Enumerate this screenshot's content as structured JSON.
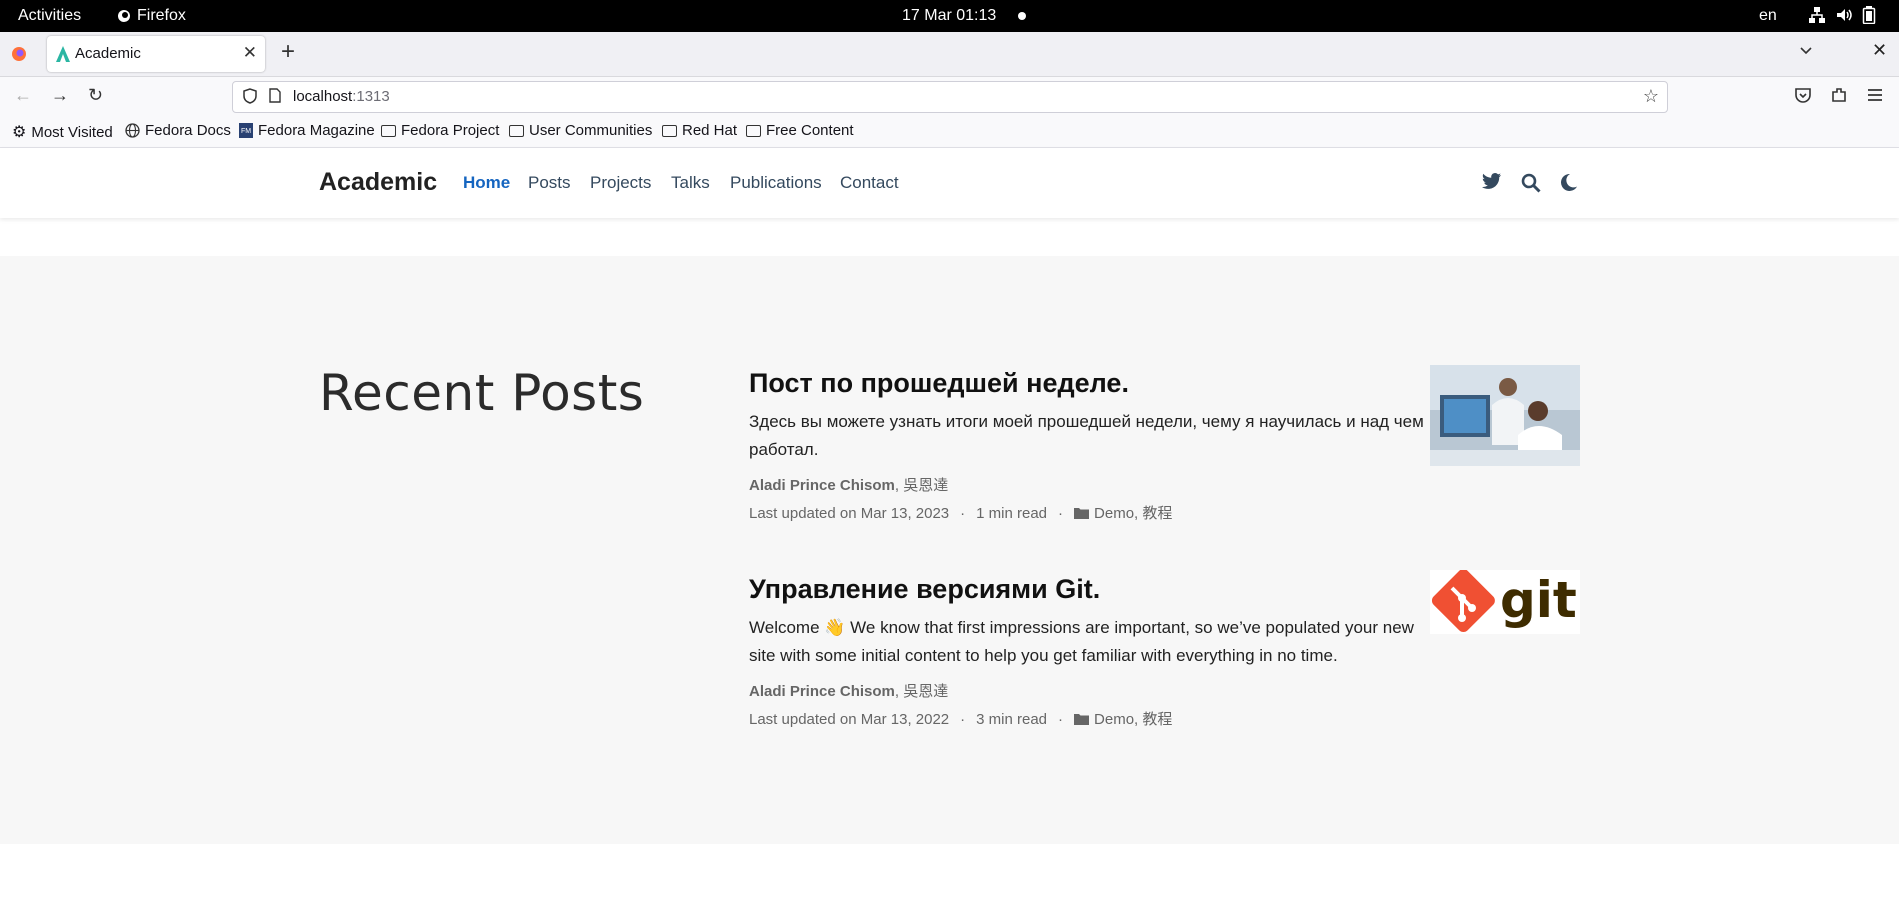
{
  "system_bar": {
    "activities": "Activities",
    "app_name": "Firefox",
    "clock": "17 Mar  01:13",
    "language": "en"
  },
  "browser": {
    "tab_title": "Academic",
    "url_host": "localhost",
    "url_port": ":1313",
    "bookmarks": [
      {
        "label": "Most Visited",
        "icon": "gear-icon"
      },
      {
        "label": "Fedora Docs",
        "icon": "globe-icon"
      },
      {
        "label": "Fedora Magazine",
        "icon": "fm-icon"
      },
      {
        "label": "Fedora Project",
        "icon": "folder-icon"
      },
      {
        "label": "User Communities",
        "icon": "folder-icon"
      },
      {
        "label": "Red Hat",
        "icon": "folder-icon"
      },
      {
        "label": "Free Content",
        "icon": "folder-icon"
      }
    ]
  },
  "site": {
    "brand": "Academic",
    "menu": [
      "Home",
      "Posts",
      "Projects",
      "Talks",
      "Publications",
      "Contact"
    ],
    "accent": "#1565c0"
  },
  "main": {
    "section_title": "Recent Posts",
    "posts": [
      {
        "title": "Пост по прошедшей неделе.",
        "summary": "Здесь вы можете узнать итоги моей прошедшей недели, чему я научилась и над чем работал.",
        "author_main": "Aladi Prince Chisom",
        "author_rest": ", 吳恩達",
        "updated": "Last updated on Mar 13, 2023",
        "read_time": "1 min read",
        "categories": "Demo, 教程",
        "thumb": "scientists-photo"
      },
      {
        "title": "Управление версиями Git.",
        "summary": "Welcome 👋 We know that first impressions are important, so we’ve populated your new site with some initial content to help you get familiar with everything in no time.",
        "author_main": "Aladi Prince Chisom",
        "author_rest": ", 吳恩達",
        "updated": "Last updated on Mar 13, 2022",
        "read_time": "3 min read",
        "categories": "Demo, 教程",
        "thumb": "git-logo",
        "thumb_text": "git"
      }
    ]
  }
}
